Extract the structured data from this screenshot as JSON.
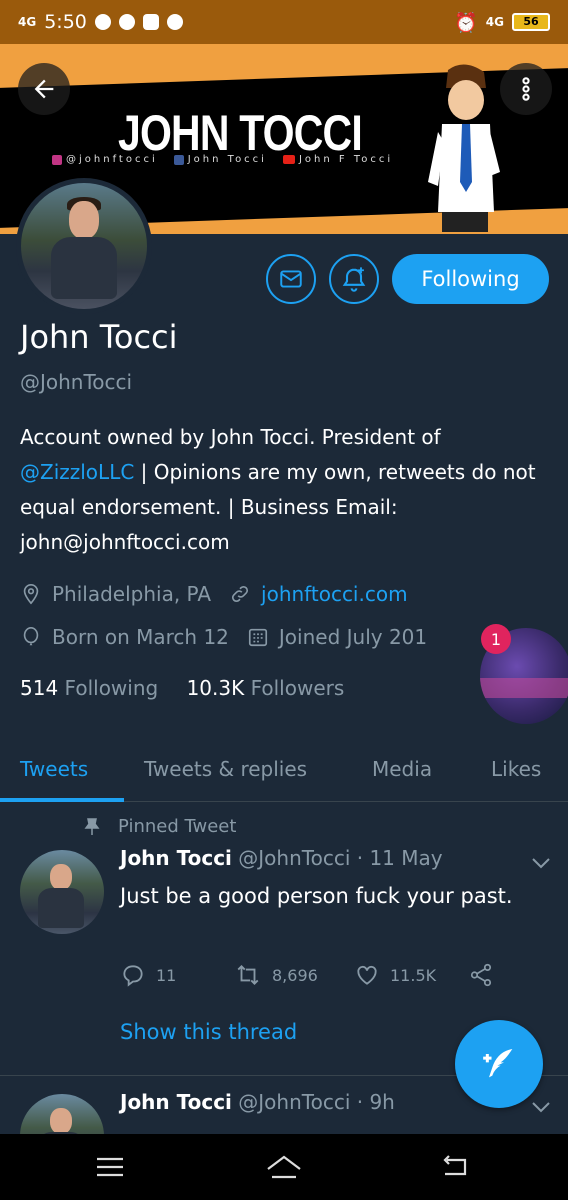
{
  "status_bar": {
    "network_left": "4G",
    "time": "5:50",
    "network_right": "4G",
    "battery": "56"
  },
  "banner": {
    "title": "JOHN TOCCI",
    "instagram": "@johnftocci",
    "facebook": "John Tocci",
    "youtube": "John F Tocci"
  },
  "profile": {
    "follow_label": "Following",
    "name": "John Tocci",
    "handle": "@JohnTocci",
    "bio_part1": "Account owned by John Tocci. President of ",
    "bio_mention": "@ZizzloLLC",
    "bio_part2": " | Opinions are my own, retweets do not equal endorsement. | Business Email: john@johnftocci.com",
    "location": "Philadelphia, PA",
    "website": "johnftocci.com",
    "birthday": "Born on March 12",
    "joined": "Joined July 201",
    "following_count": "514",
    "following_label": "Following",
    "followers_count": "10.3K",
    "followers_label": "Followers"
  },
  "notification_badge": "1",
  "tabs": [
    "Tweets",
    "Tweets & replies",
    "Media",
    "Likes"
  ],
  "tweets": [
    {
      "pinned_label": "Pinned Tweet",
      "name": "John Tocci",
      "meta": "@JohnTocci · 11 May",
      "text": "Just be a good person fuck your past.",
      "replies": "11",
      "retweets": "8,696",
      "likes": "11.5K",
      "thread_label": "Show this thread"
    },
    {
      "name": "John Tocci",
      "meta": "@JohnTocci · 9h"
    }
  ],
  "icons": {
    "back": "back-arrow-icon",
    "more": "more-vertical-icon",
    "message": "mail-icon",
    "notify": "bell-plus-icon",
    "location": "location-pin-icon",
    "link": "link-icon",
    "birthday": "balloon-icon",
    "calendar": "calendar-icon",
    "compose": "compose-feather-icon"
  },
  "colors": {
    "accent": "#1da1f2",
    "background": "#1c2938",
    "secondary_text": "#8899a6",
    "status_bar": "#9a5a0c",
    "banner_orange": "#f0a040",
    "badge": "#e0245e"
  }
}
